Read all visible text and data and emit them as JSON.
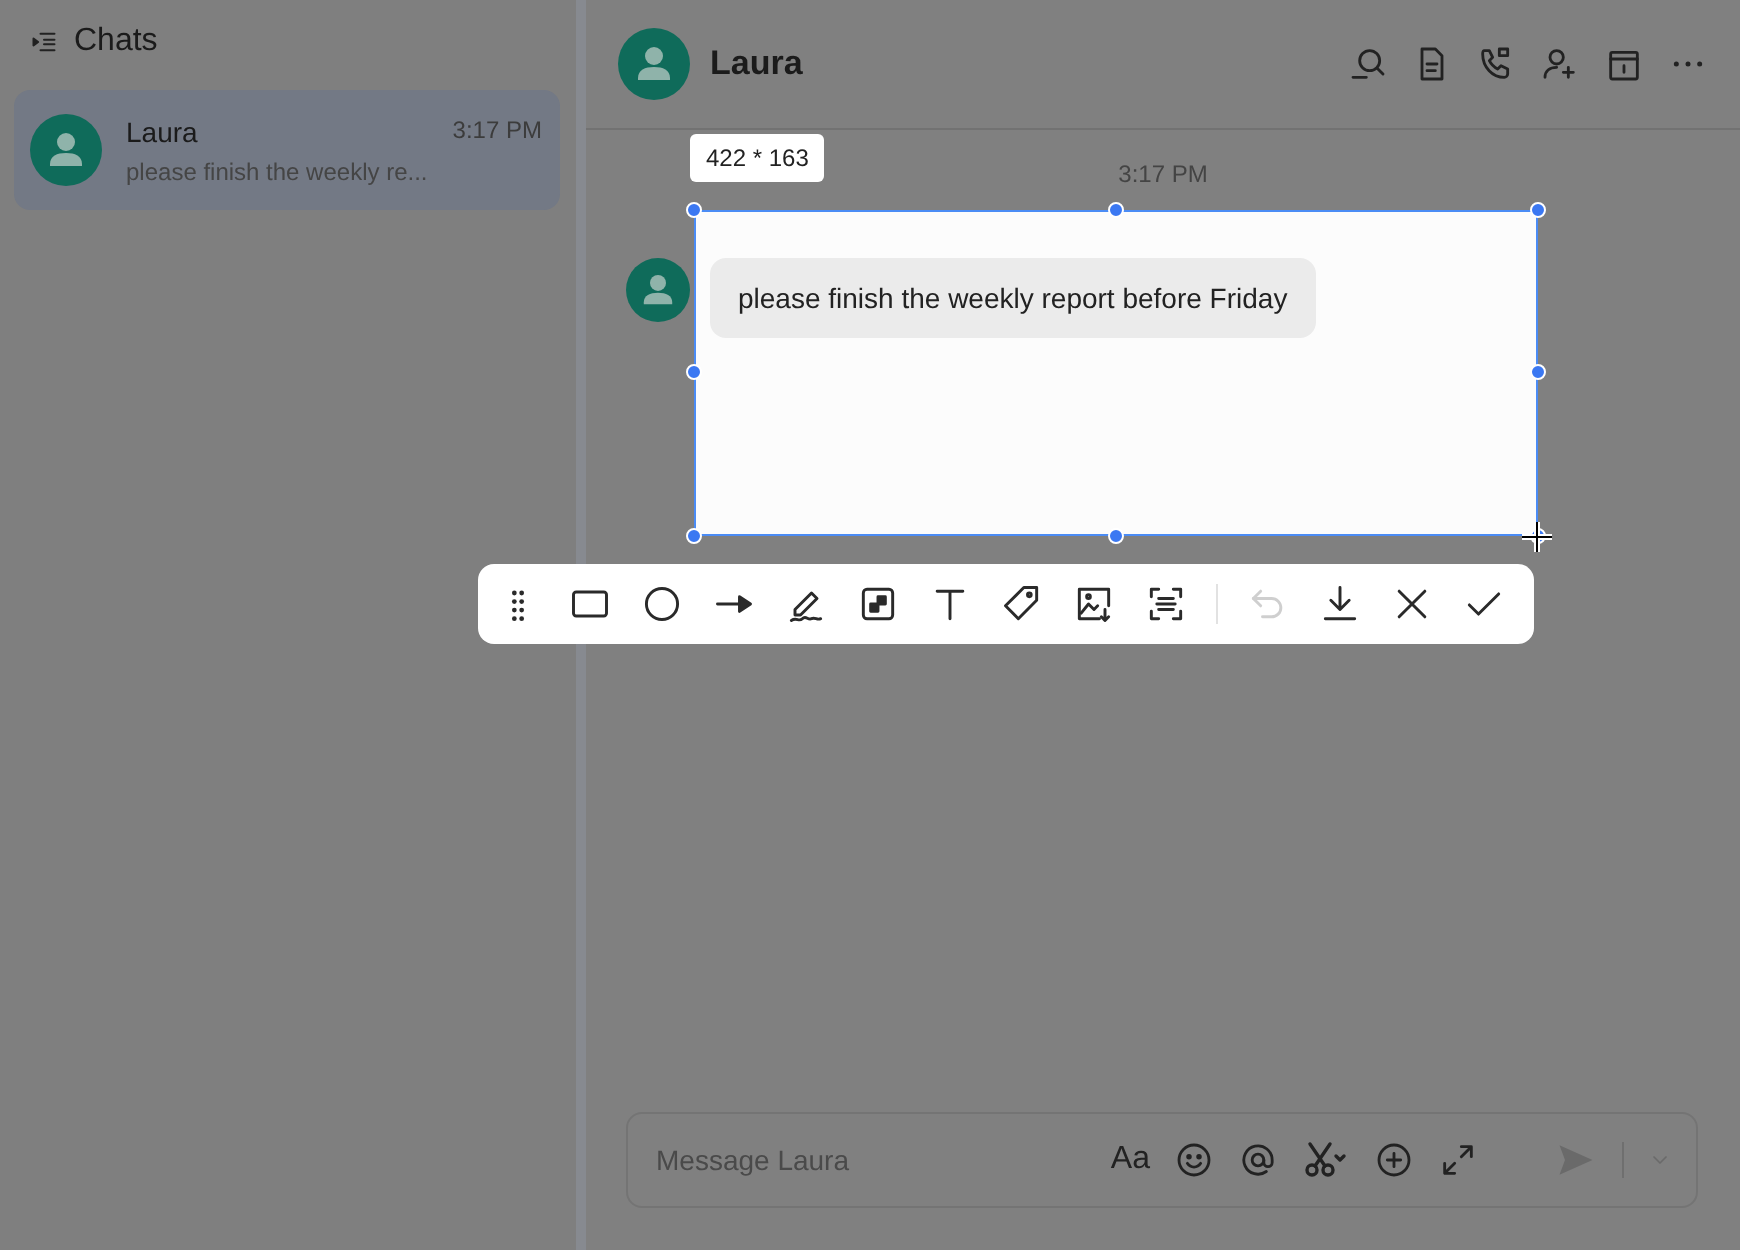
{
  "sidebar": {
    "title": "Chats",
    "chats": [
      {
        "name": "Laura",
        "time": "3:17 PM",
        "preview": "please finish the weekly re...",
        "selected": true
      }
    ]
  },
  "chat": {
    "title": "Laura",
    "timestamp": "3:17 PM",
    "messages": [
      {
        "text": "please finish the weekly report before Friday"
      }
    ]
  },
  "capture": {
    "size_label": "422 * 163",
    "tools": [
      {
        "kind": "drag",
        "disabled": false
      },
      {
        "kind": "rectangle",
        "disabled": false
      },
      {
        "kind": "ellipse",
        "disabled": false
      },
      {
        "kind": "arrow",
        "disabled": false
      },
      {
        "kind": "pen",
        "disabled": false
      },
      {
        "kind": "mosaic",
        "disabled": false
      },
      {
        "kind": "text",
        "disabled": false
      },
      {
        "kind": "tag",
        "disabled": false
      },
      {
        "kind": "image",
        "disabled": false
      },
      {
        "kind": "scan",
        "disabled": false
      }
    ],
    "actions": [
      {
        "kind": "undo",
        "disabled": true
      },
      {
        "kind": "download",
        "disabled": false
      },
      {
        "kind": "cancel",
        "disabled": false
      },
      {
        "kind": "confirm",
        "disabled": false
      }
    ]
  },
  "composer": {
    "placeholder": "Message Laura",
    "format_label": "Aa"
  }
}
